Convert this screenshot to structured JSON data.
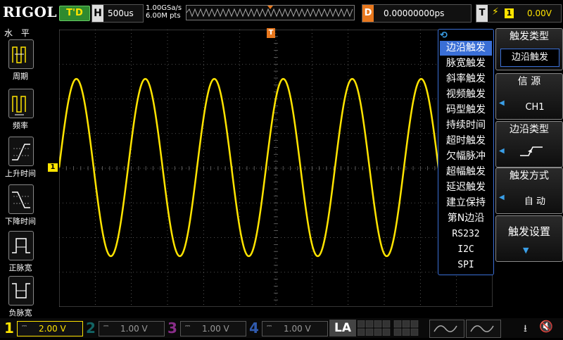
{
  "header": {
    "brand": "RIGOL",
    "run_status": "T'D",
    "timebase_label": "H",
    "timebase_value": "500us",
    "sample_rate": "1.00GSa/s",
    "memory_depth": "6.00M pts",
    "delay_label": "D",
    "delay_value": "0.00000000ps",
    "trigger_label": "T",
    "trigger_source": "1",
    "trigger_level": "0.00V"
  },
  "left_menu": {
    "title": "水 平",
    "items": [
      {
        "label": "周期",
        "icon": "period-icon"
      },
      {
        "label": "频率",
        "icon": "frequency-icon"
      },
      {
        "label": "上升时间",
        "icon": "rise-time-icon"
      },
      {
        "label": "下降时间",
        "icon": "fall-time-icon"
      },
      {
        "label": "正脉宽",
        "icon": "positive-width-icon"
      },
      {
        "label": "负脉宽",
        "icon": "negative-width-icon"
      }
    ]
  },
  "channel_marker": "1",
  "trigger_marker": "T",
  "trigger_type_menu": {
    "items": [
      "边沿触发",
      "脉宽触发",
      "斜率触发",
      "视频触发",
      "码型触发",
      "持续时间",
      "超时触发",
      "欠幅脉冲",
      "超幅触发",
      "延迟触发",
      "建立保持",
      "第N边沿",
      "RS232",
      "I2C",
      "SPI"
    ],
    "selected": "边沿触发"
  },
  "softkeys": {
    "trigger_type": {
      "title": "触发类型",
      "value": "边沿触发"
    },
    "source": {
      "title": "信 源",
      "value": "CH1"
    },
    "edge_type": {
      "title": "边沿类型"
    },
    "sweep": {
      "title": "触发方式",
      "value": "自 动"
    },
    "settings": {
      "title": "触发设置"
    }
  },
  "channels": [
    {
      "num": "1",
      "value": "2.00 V",
      "color": "#ffe400",
      "active": true
    },
    {
      "num": "2",
      "value": "1.00 V",
      "color": "#19a0a0",
      "active": false
    },
    {
      "num": "3",
      "value": "1.00 V",
      "color": "#c03cc0",
      "active": false
    },
    {
      "num": "4",
      "value": "1.00 V",
      "color": "#3a6fd6",
      "active": false
    }
  ],
  "la": {
    "label": "LA"
  },
  "colors": {
    "ch1": "#ffe400",
    "grid": "#6a6a6a",
    "accent": "#3a6fd6",
    "trigger": "#e8781e"
  }
}
